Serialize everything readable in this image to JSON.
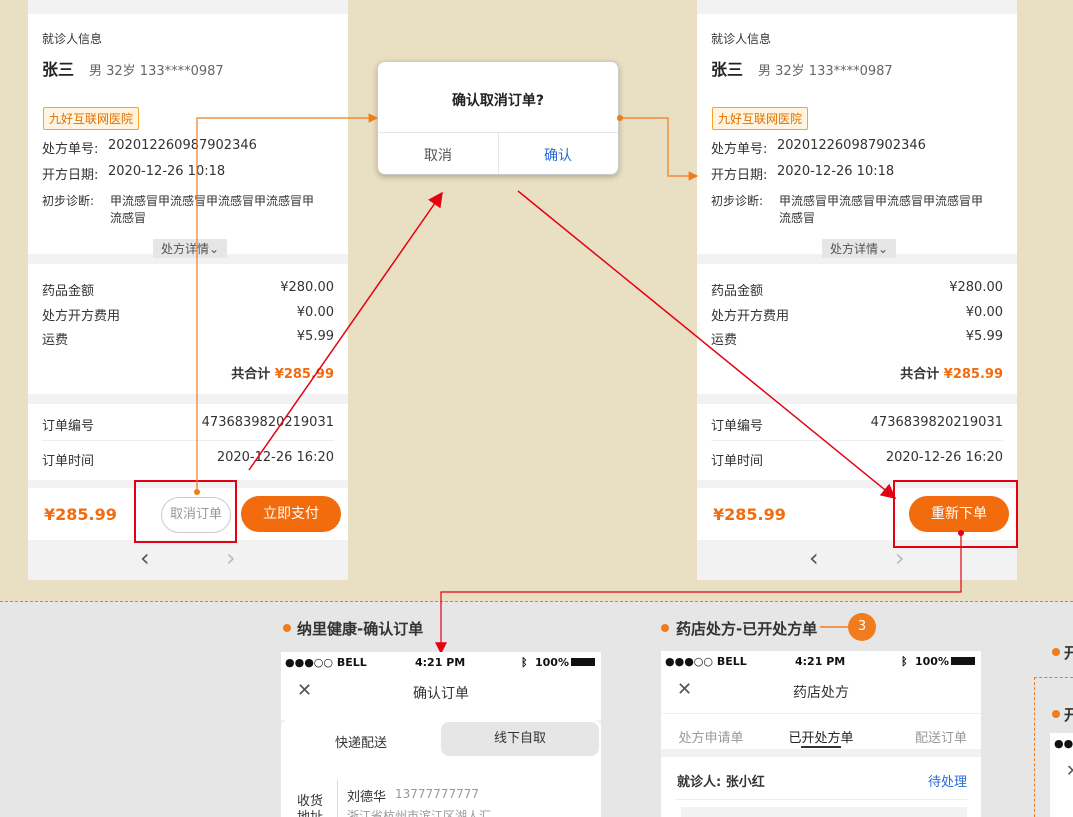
{
  "patient_info": {
    "section_label": "就诊人信息",
    "name": "张三",
    "meta": "男 32岁 133****0987",
    "hospital_tag": "九好互联网医院",
    "rx_no_label": "处方单号:",
    "rx_no": "202012260987902346",
    "date_label": "开方日期:",
    "date": "2020-12-26 10:18",
    "diag_label": "初步诊断:",
    "diag_line1": "甲流感冒甲流感冒甲流感冒甲流感冒甲",
    "diag_line2": "流感冒",
    "detail_toggle": "处方详情"
  },
  "fees": {
    "drug_label": "药品金额",
    "drug_value": "¥280.00",
    "rx_fee_label": "处方开方费用",
    "rx_fee_value": "¥0.00",
    "ship_label": "运费",
    "ship_value": "¥5.99",
    "total_label": "共合计",
    "total_value": "¥285.99"
  },
  "order": {
    "no_label": "订单编号",
    "no_value": "4736839820219031",
    "time_label": "订单时间",
    "time_value": "2020-12-26 16:20"
  },
  "footer": {
    "amount": "¥285.99",
    "cancel_btn": "取消订单",
    "pay_btn": "立即支付",
    "reorder_btn": "重新下单"
  },
  "nav": {
    "prev": "‹",
    "next": "›"
  },
  "dialog": {
    "title": "确认取消订单?",
    "cancel": "取消",
    "confirm": "确认"
  },
  "section1": {
    "title": "纳里健康-确认订单",
    "status_carrier": "●●●○○ BELL",
    "status_time": "4:21 PM",
    "status_battery": "100%",
    "page_title": "确认订单",
    "tab_express": "快递配送",
    "tab_pickup": "线下自取",
    "address_label_1": "收货",
    "address_label_2": "地址",
    "receiver_name": "刘德华",
    "receiver_phone": "13777777777",
    "address_line": "浙江省杭州市滨江区湖人汇"
  },
  "section2": {
    "title": "药店处方-已开处方单",
    "badge": "3",
    "status_carrier": "●●●○○ BELL",
    "status_time": "4:21 PM",
    "status_battery": "100%",
    "page_title": "药店处方",
    "tab1": "处方申请单",
    "tab2": "已开处方单",
    "tab3": "配送订单",
    "patient_label": "就诊人: 张小红",
    "patient_status": "待处理"
  },
  "section3": {
    "title_fragment": "开",
    "title_fragment2": "开",
    "status_dots": "●●"
  },
  "colors": {
    "accent": "#f26b0d",
    "highlight_box": "#e60012",
    "link_blue": "#2a6ad8"
  }
}
